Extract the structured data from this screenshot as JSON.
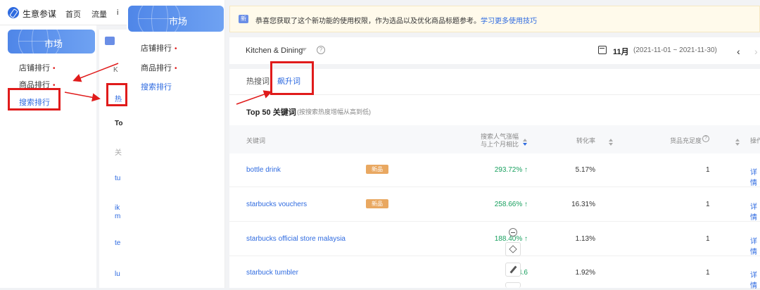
{
  "bg_app": {
    "brand": "生意参谋",
    "nav": [
      "首页",
      "流量",
      "i"
    ],
    "market_label": "市场",
    "side_items": [
      {
        "label": "店铺排行",
        "dot": "•"
      },
      {
        "label": "商品排行",
        "dot": "•"
      },
      {
        "label": "搜索排行"
      }
    ],
    "strip_texts": [
      "K",
      "热",
      "To",
      "关",
      "tu",
      "ik",
      "m",
      "te",
      "lu"
    ]
  },
  "overlay_sidebar": {
    "market_label": "市场",
    "items": [
      {
        "label": "店铺排行",
        "dot": "•"
      },
      {
        "label": "商品排行",
        "dot": "•"
      },
      {
        "label": "搜索排行"
      }
    ]
  },
  "notice": {
    "icon": "新",
    "text": "恭喜您获取了这个新功能的使用权限，作为选品以及优化商品标题参考。",
    "link": "学习更多使用技巧"
  },
  "filter": {
    "category": "Kitchen & Dining",
    "help": "?",
    "month": "11月",
    "range": "(2021-11-01 ~ 2021-11-30)",
    "prev": "‹",
    "next": "›"
  },
  "tabs": {
    "hot": "热搜词",
    "rising": "飙升词"
  },
  "section": {
    "title": "Top 50 关键词",
    "subtitle": "(按搜索热度增幅从高到低)"
  },
  "table": {
    "headers": {
      "keyword": "关键词",
      "growth_line1": "搜索人气涨幅",
      "growth_line2": "与上个月相比",
      "conversion": "转化率",
      "supply": "货品充足度",
      "supply_help": "?",
      "op": "操作"
    },
    "rows": [
      {
        "keyword": "bottle drink",
        "tag": "新品",
        "growth": "293.72% ↑",
        "conv": "5.17%",
        "supply": "1",
        "op": "详情"
      },
      {
        "keyword": "starbucks vouchers",
        "tag": "新品",
        "growth": "258.66% ↑",
        "conv": "16.31%",
        "supply": "1",
        "op": "详情"
      },
      {
        "keyword": "starbucks official store malaysia",
        "tag": "",
        "growth": "188.40% ↑",
        "conv": "1.13%",
        "supply": "1",
        "op": "详情"
      },
      {
        "keyword": "starbuck tumbler",
        "tag": "",
        "growth": "174.6",
        "conv": "1.92%",
        "supply": "1",
        "op": "详情"
      }
    ]
  },
  "colors": {
    "accent": "#2f6be0",
    "growth": "#19a05f",
    "annotation": "#e01b1b",
    "new_tag": "#e9a861"
  }
}
